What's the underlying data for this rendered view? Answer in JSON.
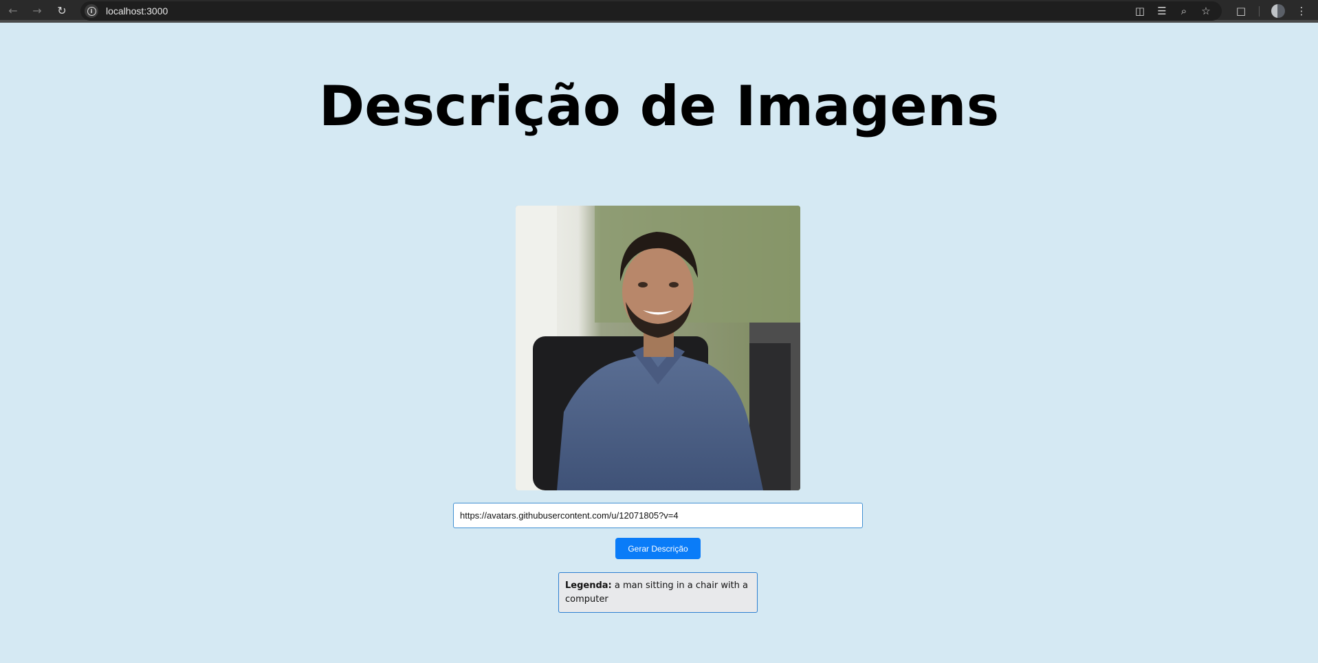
{
  "browser": {
    "url": "localhost:3000",
    "icons": [
      "back-arrow-icon",
      "forward-arrow-icon",
      "reload-icon",
      "site-info-icon",
      "install-app-icon",
      "translate-icon",
      "zoom-icon",
      "bookmark-star-icon",
      "extensions-icon",
      "profile-avatar",
      "more-menu-icon"
    ]
  },
  "page": {
    "title": "Descrição de Imagens",
    "image_alt": "",
    "url_input_value": "https://avatars.githubusercontent.com/u/12071805?v=4",
    "generate_button_label": "Gerar Descrição",
    "caption_label": "Legenda:",
    "caption_text": " a man sitting in a chair with a computer"
  },
  "colors": {
    "background": "#d5e9f3",
    "accent": "#0a7cf8",
    "border": "#2c7fd0"
  }
}
